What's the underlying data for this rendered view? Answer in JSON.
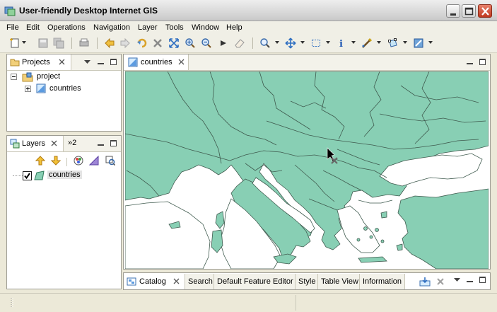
{
  "window": {
    "title": "User-friendly Desktop Internet GIS"
  },
  "menu": [
    "File",
    "Edit",
    "Operations",
    "Navigation",
    "Layer",
    "Tools",
    "Window",
    "Help"
  ],
  "toolbar_icons": [
    "new-icon",
    "save-icon",
    "save-all-icon",
    "print-icon",
    "back-icon",
    "forward-icon",
    "refresh-icon",
    "stop-icon",
    "zoom-extent-icon",
    "zoom-in-icon",
    "zoom-out-icon",
    "play-icon",
    "eraser-icon",
    "zoom-tool-icon",
    "pan-icon",
    "select-rect-icon",
    "info-icon",
    "edit-tool-icon",
    "vertex-tool-icon",
    "style-tool-icon"
  ],
  "projects_panel": {
    "tab_label": "Projects",
    "tree": {
      "root": "project",
      "child": "countries"
    }
  },
  "layers_panel": {
    "tab_label": "Layers",
    "overflow_label": "»2",
    "layer": {
      "name": "countries",
      "checked": true
    }
  },
  "map_editor": {
    "tab_label": "countries"
  },
  "bottom_tabs": [
    "Catalog",
    "Search",
    "Default Feature Editor",
    "Style",
    "Table View",
    "Information"
  ],
  "colors": {
    "land": "#88cfb4",
    "border": "#3f5a4e",
    "sea": "#ffffff",
    "chrome": "#ece9d8"
  }
}
